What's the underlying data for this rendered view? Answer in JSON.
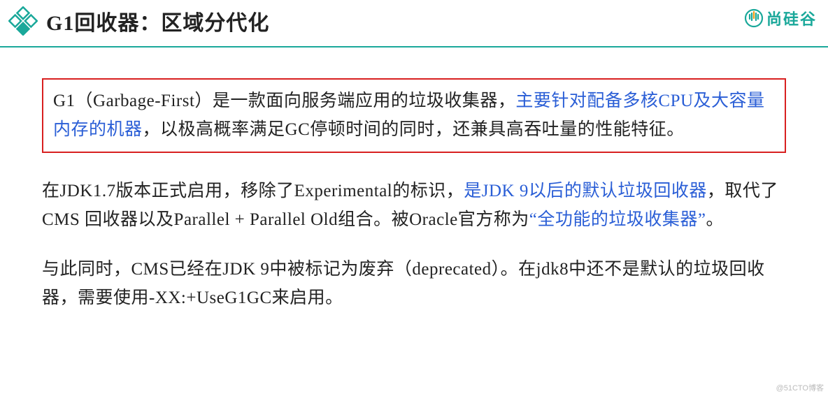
{
  "header": {
    "title": "G1回收器：区域分代化",
    "brand": "尚硅谷"
  },
  "paragraphs": {
    "p1": {
      "seg1": "G1（Garbage-First）是一款面向服务端应用的垃圾收集器，",
      "seg2_hl": "主要针对配备多核CPU及大容量内存的机器",
      "seg3": "，以极高概率满足GC停顿时间的同时，还兼具高吞吐量的性能特征。"
    },
    "p2": {
      "seg1": "在JDK1.7版本正式启用，移除了Experimental的标识，",
      "seg2_hl": "是JDK 9以后的默认垃圾回收器",
      "seg3": "，取代了CMS 回收器以及Parallel + Parallel Old组合。被Oracle官方称为",
      "seg4_hl": "“全功能的垃圾收集器”",
      "seg5": "。"
    },
    "p3": {
      "seg1": "与此同时，CMS已经在JDK 9中被标记为废弃（deprecated）。在jdk8中还不是默认的垃圾回收器，需要使用-XX:+UseG1GC来启用。"
    }
  },
  "watermark": "@51CTO博客"
}
